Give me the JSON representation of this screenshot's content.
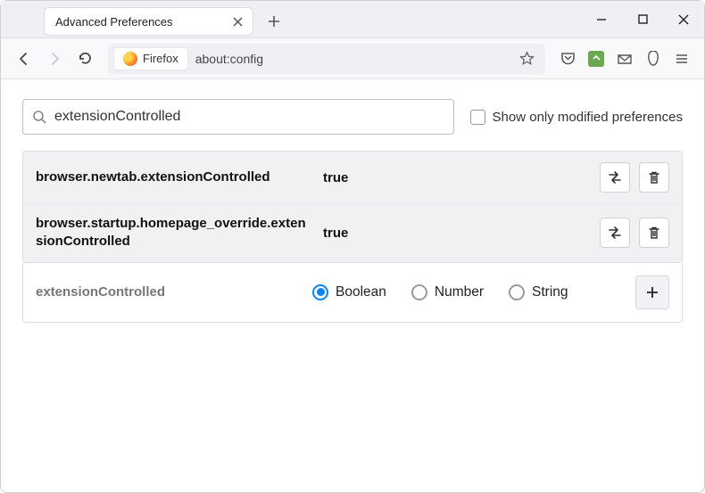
{
  "window": {
    "tab_title": "Advanced Preferences"
  },
  "urlbar": {
    "identity_label": "Firefox",
    "url": "about:config"
  },
  "config": {
    "search_value": "extensionControlled",
    "show_modified_label": "Show only modified preferences",
    "show_modified_checked": false,
    "prefs": [
      {
        "name": "browser.newtab.extensionControlled",
        "value": "true"
      },
      {
        "name": "browser.startup.homepage_override.extensionControlled",
        "value": "true"
      }
    ],
    "new_pref": {
      "name": "extensionControlled",
      "types": [
        {
          "label": "Boolean",
          "selected": true
        },
        {
          "label": "Number",
          "selected": false
        },
        {
          "label": "String",
          "selected": false
        }
      ]
    }
  }
}
